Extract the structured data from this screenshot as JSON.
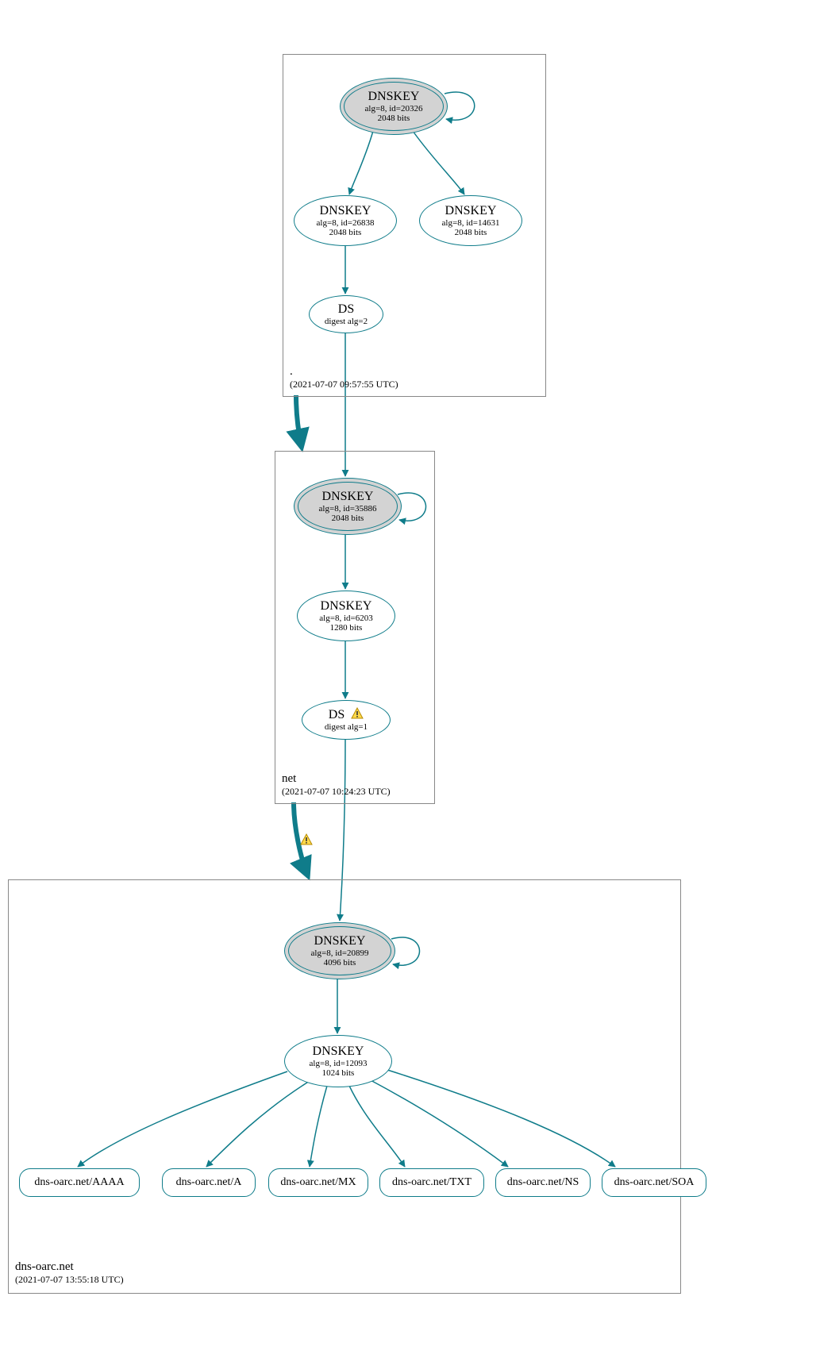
{
  "colors": {
    "stroke": "#0f7c8a",
    "zoneBorder": "#888888",
    "kskFill": "#d3d3d3"
  },
  "zones": {
    "root": {
      "name": ".",
      "time": "(2021-07-07 09:57:55 UTC)"
    },
    "net": {
      "name": "net",
      "time": "(2021-07-07 10:24:23 UTC)"
    },
    "dnsoarc": {
      "name": "dns-oarc.net",
      "time": "(2021-07-07 13:55:18 UTC)"
    }
  },
  "nodes": {
    "rootKsk": {
      "title": "DNSKEY",
      "sub1": "alg=8, id=20326",
      "sub2": "2048 bits"
    },
    "rootZsk1": {
      "title": "DNSKEY",
      "sub1": "alg=8, id=26838",
      "sub2": "2048 bits"
    },
    "rootZsk2": {
      "title": "DNSKEY",
      "sub1": "alg=8, id=14631",
      "sub2": "2048 bits"
    },
    "rootDs": {
      "title": "DS",
      "sub1": "digest alg=2"
    },
    "netKsk": {
      "title": "DNSKEY",
      "sub1": "alg=8, id=35886",
      "sub2": "2048 bits"
    },
    "netZsk": {
      "title": "DNSKEY",
      "sub1": "alg=8, id=6203",
      "sub2": "1280 bits"
    },
    "netDs": {
      "title": "DS",
      "sub1": "digest alg=1"
    },
    "leafKsk": {
      "title": "DNSKEY",
      "sub1": "alg=8, id=20899",
      "sub2": "4096 bits"
    },
    "leafZsk": {
      "title": "DNSKEY",
      "sub1": "alg=8, id=12093",
      "sub2": "1024 bits"
    }
  },
  "rrs": {
    "aaaa": "dns-oarc.net/AAAA",
    "a": "dns-oarc.net/A",
    "mx": "dns-oarc.net/MX",
    "txt": "dns-oarc.net/TXT",
    "ns": "dns-oarc.net/NS",
    "soa": "dns-oarc.net/SOA"
  }
}
